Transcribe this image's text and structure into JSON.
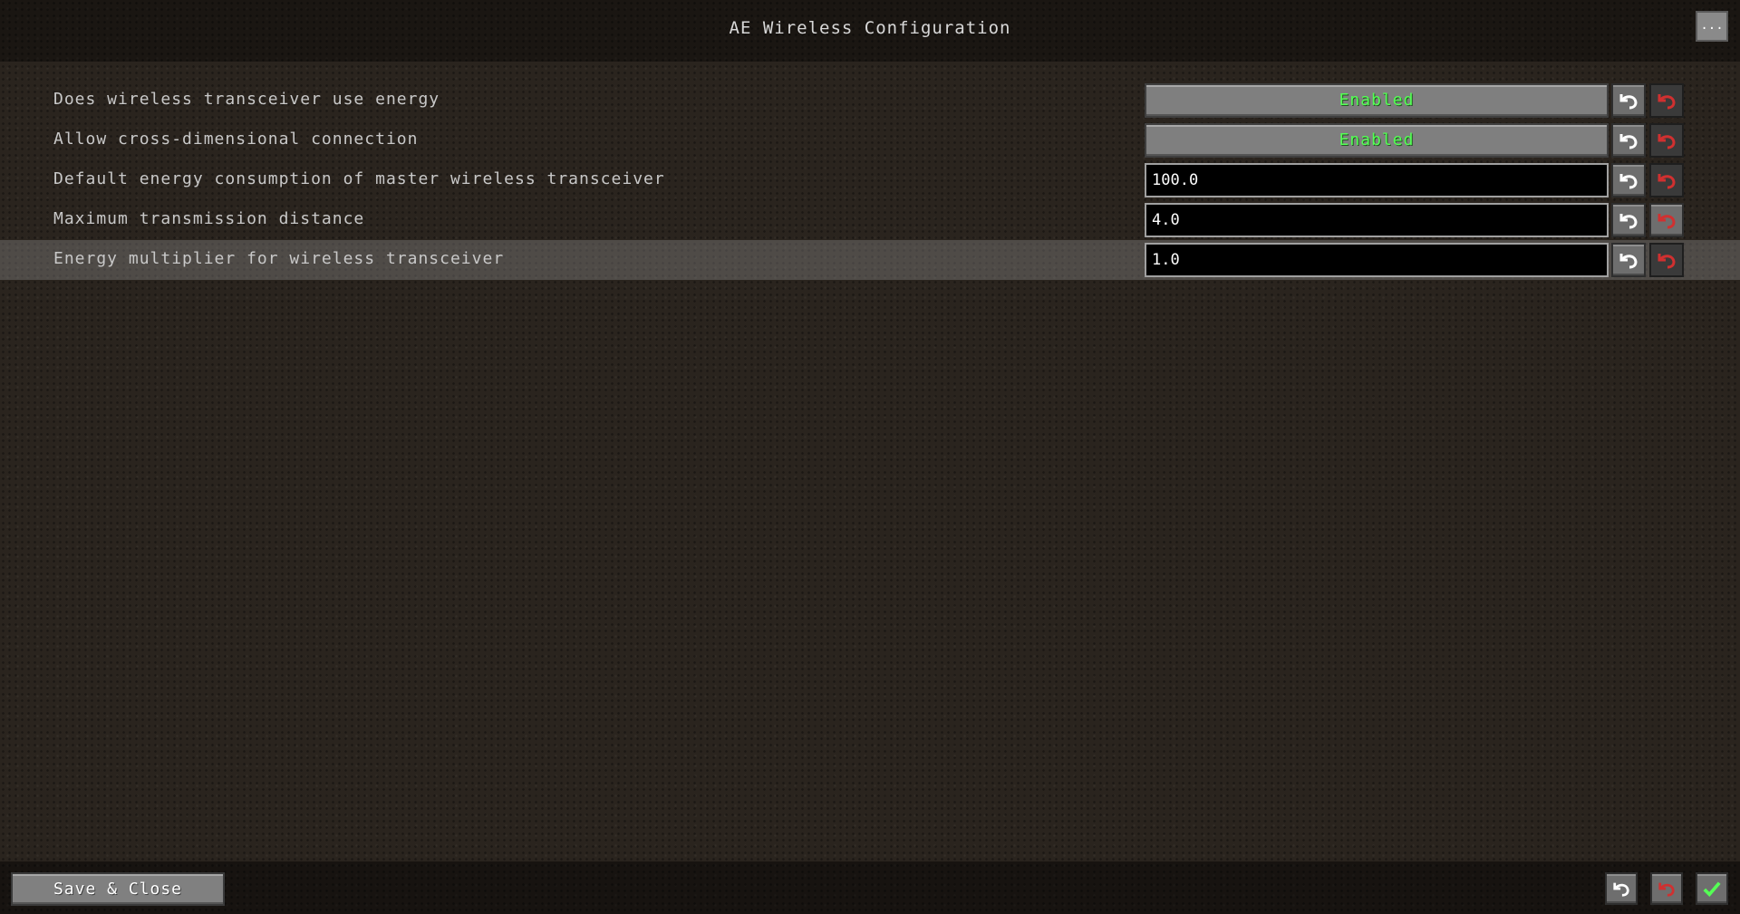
{
  "window": {
    "title": "AE Wireless Configuration",
    "menu_label": "..."
  },
  "settings": [
    {
      "label": "Does wireless transceiver use energy",
      "type": "toggle",
      "value": "Enabled"
    },
    {
      "label": "Allow cross-dimensional connection",
      "type": "toggle",
      "value": "Enabled"
    },
    {
      "label": "Default energy consumption of master wireless transceiver",
      "type": "number",
      "value": "100.0"
    },
    {
      "label": "Maximum transmission distance",
      "type": "number",
      "value": "4.0"
    },
    {
      "label": "Energy multiplier for wireless transceiver",
      "type": "number",
      "value": "1.0"
    }
  ],
  "footer": {
    "save_label": "Save & Close"
  },
  "colors": {
    "enabled_text": "#55ff55",
    "undo_icon": "#ffffff",
    "reset_icon": "#d03030",
    "done_icon": "#55ff55"
  },
  "icons": {
    "undo": "undo-arrow-icon",
    "reset": "reset-arrow-icon",
    "done": "checkmark-icon"
  }
}
